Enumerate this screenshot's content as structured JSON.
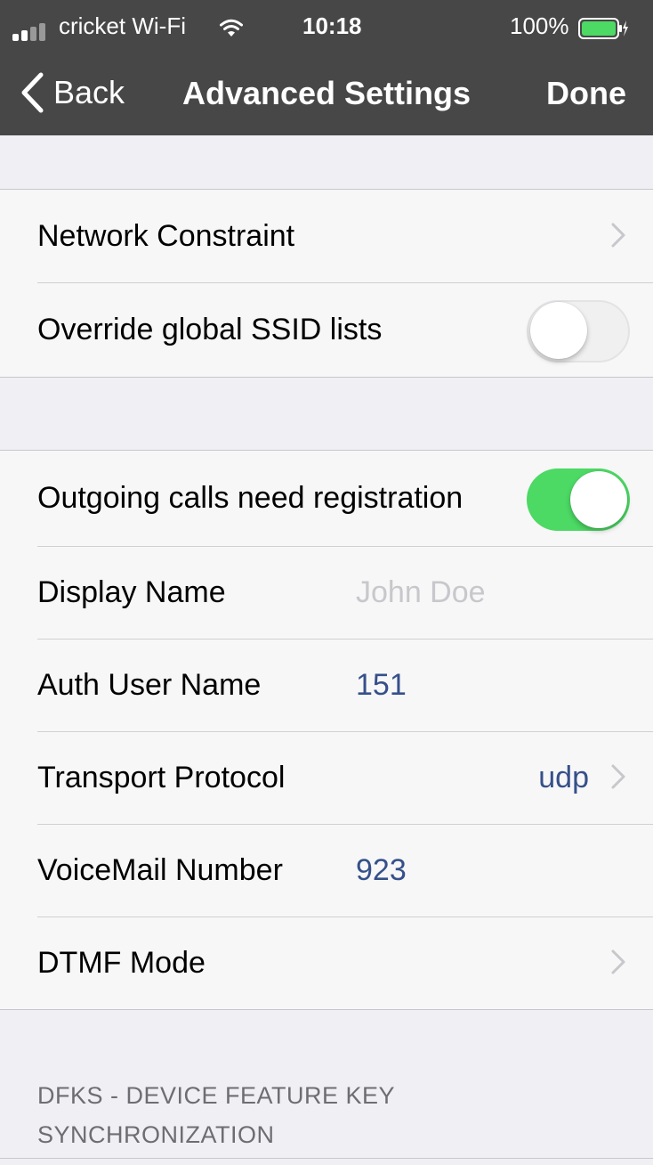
{
  "status_bar": {
    "carrier": "cricket Wi-Fi",
    "time": "10:18",
    "battery_percent": "100%",
    "battery_level": 1.0,
    "signal_bars": 2,
    "icons": [
      "signal-icon",
      "wifi-icon",
      "battery-icon",
      "charging-icon"
    ]
  },
  "nav": {
    "back_label": "Back",
    "title": "Advanced Settings",
    "done_label": "Done"
  },
  "group1": {
    "network_constraint": {
      "label": "Network Constraint"
    },
    "override_ssid": {
      "label": "Override global SSID lists",
      "enabled": false
    }
  },
  "group2": {
    "outgoing_calls": {
      "label": "Outgoing calls need registration",
      "enabled": true
    },
    "display_name": {
      "label": "Display Name",
      "placeholder": "John Doe"
    },
    "auth_user": {
      "label": "Auth User Name",
      "value": "151"
    },
    "transport": {
      "label": "Transport Protocol",
      "value": "udp"
    },
    "voicemail": {
      "label": "VoiceMail Number",
      "value": "923"
    },
    "dtmf": {
      "label": "DTMF Mode"
    }
  },
  "dfks_header": "DFKS - DEVICE FEATURE KEY SYNCHRONIZATION",
  "colors": {
    "nav_background": "#474747",
    "switch_on": "#4cd964",
    "value_blue": "#35508a",
    "placeholder_gray": "#c7c7cc"
  }
}
